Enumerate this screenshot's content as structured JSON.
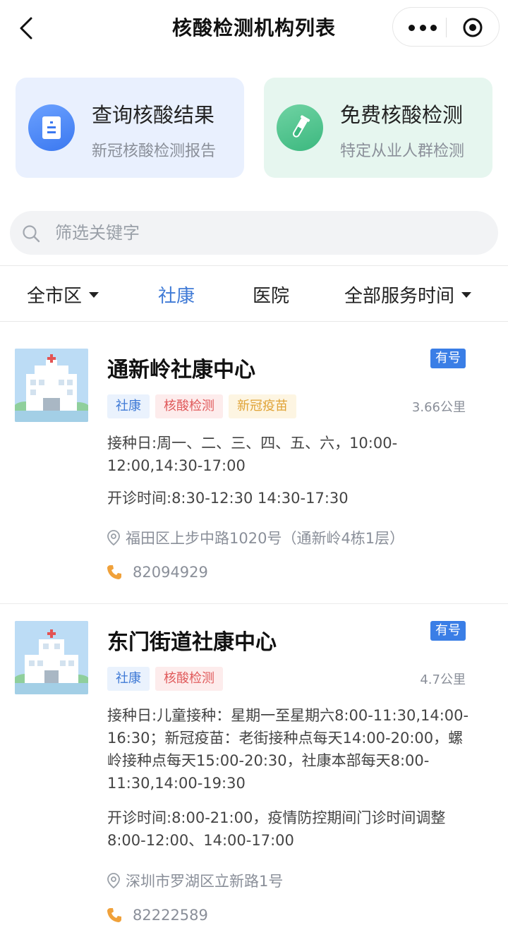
{
  "header": {
    "title": "核酸检测机构列表"
  },
  "cards": [
    {
      "title": "查询核酸结果",
      "subtitle": "新冠核酸检测报告",
      "icon": "document-icon"
    },
    {
      "title": "免费核酸检测",
      "subtitle": "特定从业人群检测",
      "icon": "test-tube-icon"
    }
  ],
  "search": {
    "placeholder": "筛选关键字",
    "value": ""
  },
  "filters": [
    {
      "label": "全市区",
      "dropdown": true,
      "active": false
    },
    {
      "label": "社康",
      "dropdown": false,
      "active": true
    },
    {
      "label": "医院",
      "dropdown": false,
      "active": false
    },
    {
      "label": "全部服务时间",
      "dropdown": true,
      "active": false
    }
  ],
  "items": [
    {
      "name": "通新岭社康中心",
      "badge": "有号",
      "tags": [
        "社康",
        "核酸检测",
        "新冠疫苗"
      ],
      "distance": "3.66公里",
      "vaccination": "接种日:周一、二、三、四、五、六，10:00-12:00,14:30-17:00",
      "hours": "开诊时间:8:30-12:30 14:30-17:30",
      "address": "福田区上步中路1020号（通新岭4栋1层）",
      "phone": "82094929"
    },
    {
      "name": "东门街道社康中心",
      "badge": "有号",
      "tags": [
        "社康",
        "核酸检测"
      ],
      "distance": "4.7公里",
      "vaccination": "接种日:儿童接种：星期一至星期六8:00-11:30,14:00-16:30；新冠疫苗：老街接种点每天14:00-20:00，螺岭接种点每天15:00-20:30，社康本部每天8:00-11:30,14:00-19:30",
      "hours": "开诊时间:8:00-21:00，疫情防控期间门诊时间调整8:00-12:00、14:00-17:00",
      "address": "深圳市罗湖区立新路1号",
      "phone": "82222589"
    }
  ],
  "colors": {
    "accent": "#3f7ad6",
    "badge": "#3a7ee6"
  }
}
